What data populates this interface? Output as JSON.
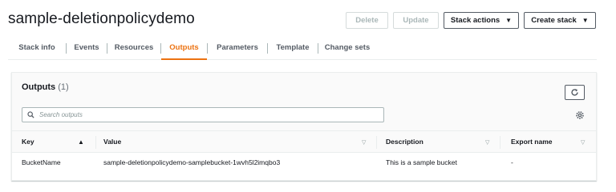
{
  "header": {
    "stack_name": "sample-deletionpolicydemo",
    "buttons": {
      "delete": "Delete",
      "update": "Update",
      "stack_actions": "Stack actions",
      "create_stack": "Create stack"
    }
  },
  "tabs": [
    {
      "label": "Stack info",
      "active": false
    },
    {
      "label": "Events",
      "active": false
    },
    {
      "label": "Resources",
      "active": false
    },
    {
      "label": "Outputs",
      "active": true
    },
    {
      "label": "Parameters",
      "active": false
    },
    {
      "label": "Template",
      "active": false
    },
    {
      "label": "Change sets",
      "active": false
    }
  ],
  "outputs_panel": {
    "title": "Outputs",
    "count": "(1)",
    "search_placeholder": "Search outputs",
    "columns": [
      "Key",
      "Value",
      "Description",
      "Export name"
    ],
    "rows": [
      {
        "key": "BucketName",
        "value": "sample-deletionpolicydemo-samplebucket-1wvh5l2imqbo3",
        "description": "This is a sample bucket",
        "export_name": "-"
      }
    ]
  },
  "colors": {
    "accent": "#ec7211",
    "text": "#16191f",
    "muted": "#545b64",
    "border": "#eaeded"
  }
}
